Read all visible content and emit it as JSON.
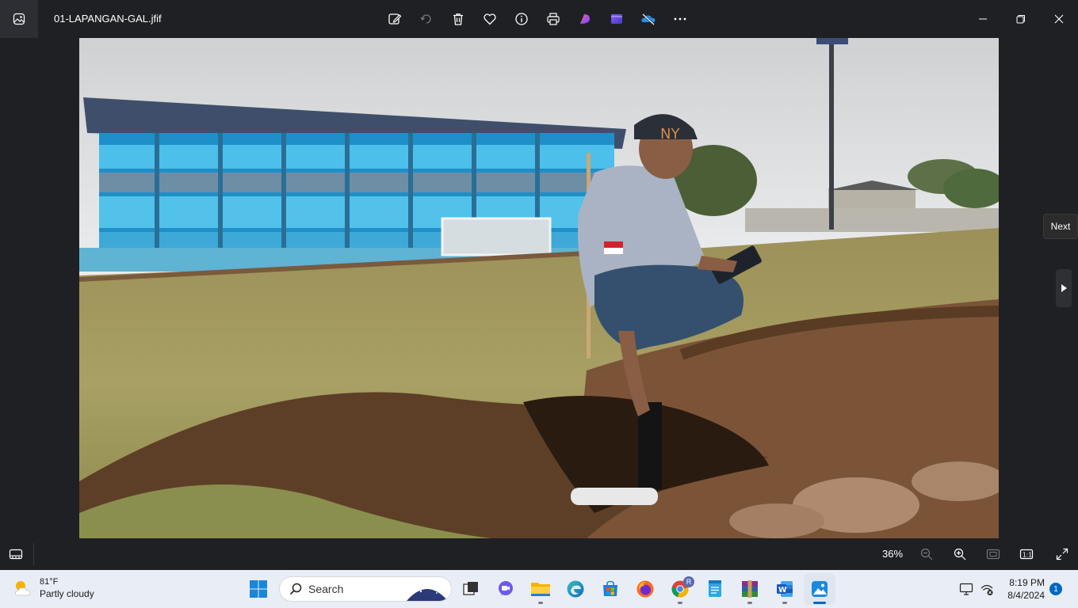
{
  "window": {
    "file_name": "01-LAPANGAN-GAL.jfif"
  },
  "toolbar": {
    "items": [
      "edit-icon",
      "rotate-icon",
      "delete-icon",
      "favorite-icon",
      "info-icon",
      "print-icon",
      "designer-icon",
      "clipchamp-icon",
      "onedrive-icon",
      "more-icon"
    ]
  },
  "viewer": {
    "next_tooltip": "Next",
    "photo_subject": "man crouching beside dug trench in stadium field"
  },
  "bottombar": {
    "zoom_level": "36%"
  },
  "taskbar": {
    "weather": {
      "temperature": "81°F",
      "condition": "Partly cloudy"
    },
    "search_label": "Search",
    "clock": {
      "time": "8:19 PM",
      "date": "8/4/2024"
    },
    "notification_count": "1",
    "chrome_badge": "R"
  },
  "colors": {
    "titlebar_bg": "#1f2024",
    "taskbar_bg": "#e9eef6",
    "accent": "#0067c0"
  }
}
